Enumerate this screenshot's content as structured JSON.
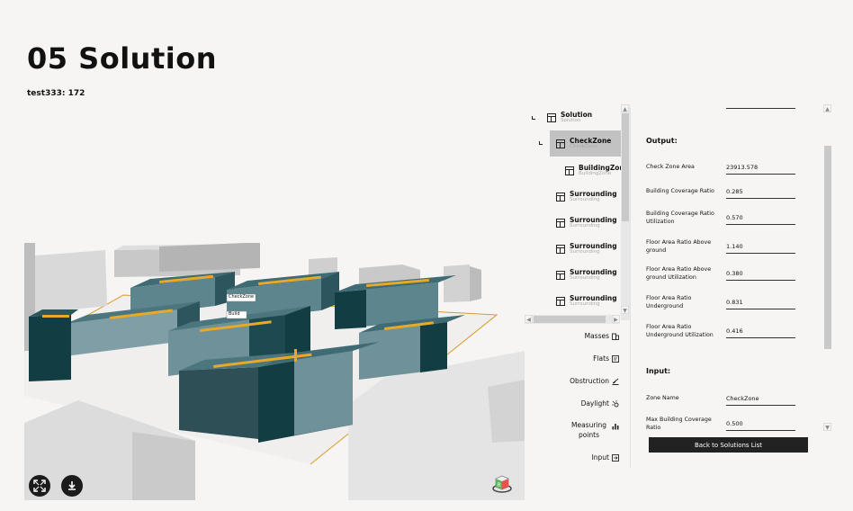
{
  "page": {
    "title": "05 Solution",
    "subtitle": "test333: 172"
  },
  "viewport": {
    "labels": [
      "CheckZone",
      "Build"
    ]
  },
  "tree": {
    "items": [
      {
        "name": "Solution",
        "type": "Solution"
      },
      {
        "name": "CheckZone",
        "type": "CheckZone",
        "selected": true
      },
      {
        "name": "BuildingZone",
        "type": "BuildingZone"
      },
      {
        "name": "Surrounding",
        "type": "Surrounding"
      },
      {
        "name": "Surrounding",
        "type": "Surrounding"
      },
      {
        "name": "Surrounding",
        "type": "Surrounding"
      },
      {
        "name": "Surrounding",
        "type": "Surrounding"
      },
      {
        "name": "Surrounding",
        "type": "Surrounding"
      }
    ]
  },
  "menu": {
    "items": [
      {
        "label": "Masses",
        "icon": "building-icon"
      },
      {
        "label": "Flats",
        "icon": "flats-icon"
      },
      {
        "label": "Obstruction",
        "icon": "obstruction-icon"
      },
      {
        "label": "Daylight",
        "icon": "daylight-icon"
      },
      {
        "label": "Measuring points",
        "icon": "bar-chart-icon"
      },
      {
        "label": "Input",
        "icon": "input-icon"
      }
    ]
  },
  "properties": {
    "output_title": "Output:",
    "output": [
      {
        "key": "Check Zone Area",
        "value": "23913.578"
      },
      {
        "key": "Building Coverage Ratio",
        "value": "0.285"
      },
      {
        "key": "Building Coverage Ratio Utilization",
        "value": "0.570"
      },
      {
        "key": "Floor Area Ratio Above ground",
        "value": "1.140"
      },
      {
        "key": "Floor Area Ratio Above ground Utilization",
        "value": "0.380"
      },
      {
        "key": "Floor Area Ratio Underground",
        "value": "0.831"
      },
      {
        "key": "Floor Area Ratio Underground Utilization",
        "value": "0.416"
      }
    ],
    "input_title": "Input:",
    "input": [
      {
        "key": "Zone Name",
        "value": "CheckZone"
      },
      {
        "key": "Max Building Coverage Ratio",
        "value": "0.500"
      }
    ]
  },
  "actions": {
    "back_label": "Back to Solutions List"
  },
  "colors": {
    "teal": "#3f6b74",
    "dark_teal": "#123d43",
    "light_teal": "#7f9ea5",
    "accent": "#e7a927",
    "dark": "#222222"
  }
}
